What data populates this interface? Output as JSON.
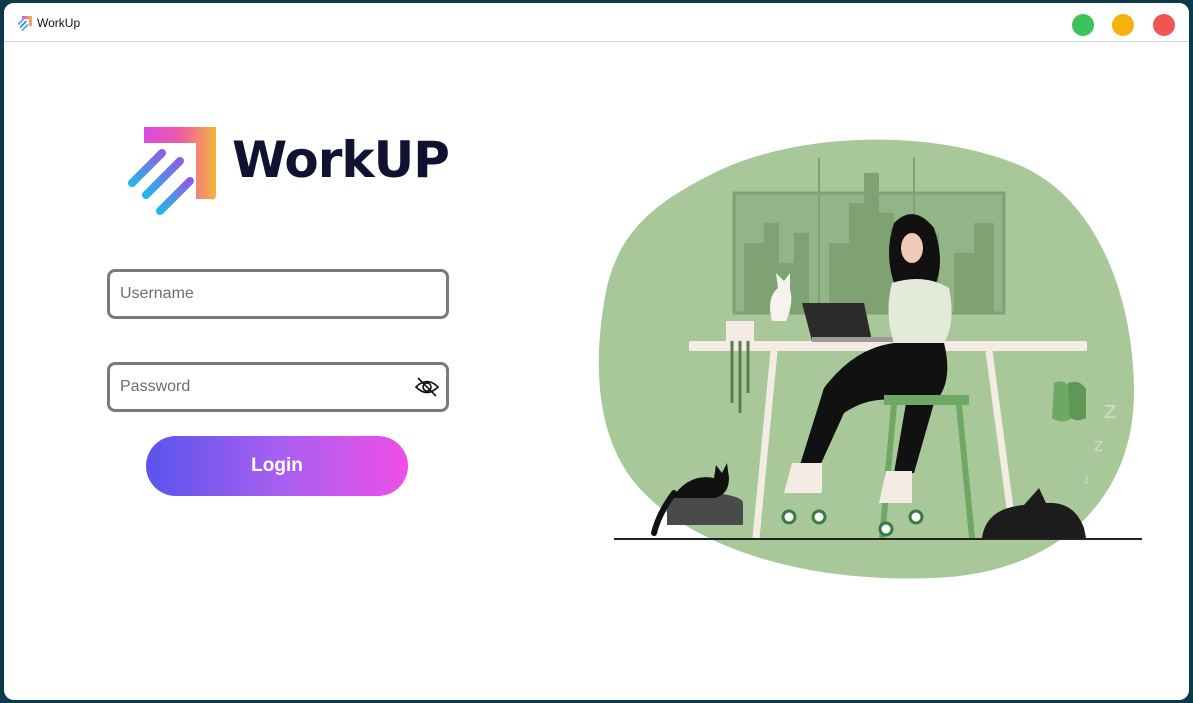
{
  "window": {
    "title": "WorkUp",
    "icon": "workup-logo-icon",
    "controls": [
      "green-dot",
      "yellow-dot",
      "red-dot"
    ]
  },
  "brand": {
    "name": "WorkUP",
    "colors": {
      "text": "#111131",
      "gradient_start": "#e34fd6",
      "gradient_end": "#f6b33a",
      "stripe": "#27b5e8"
    }
  },
  "login_form": {
    "username_placeholder": "Username",
    "password_placeholder": "Password",
    "password_toggle_icon": "eye-slash-icon",
    "login_label": "Login",
    "button_gradient": [
      "#5a54ec",
      "#ee4fe8"
    ]
  },
  "illustration": {
    "subject": "woman-working-at-laptop-illustration",
    "accent": "#a9c89a"
  }
}
